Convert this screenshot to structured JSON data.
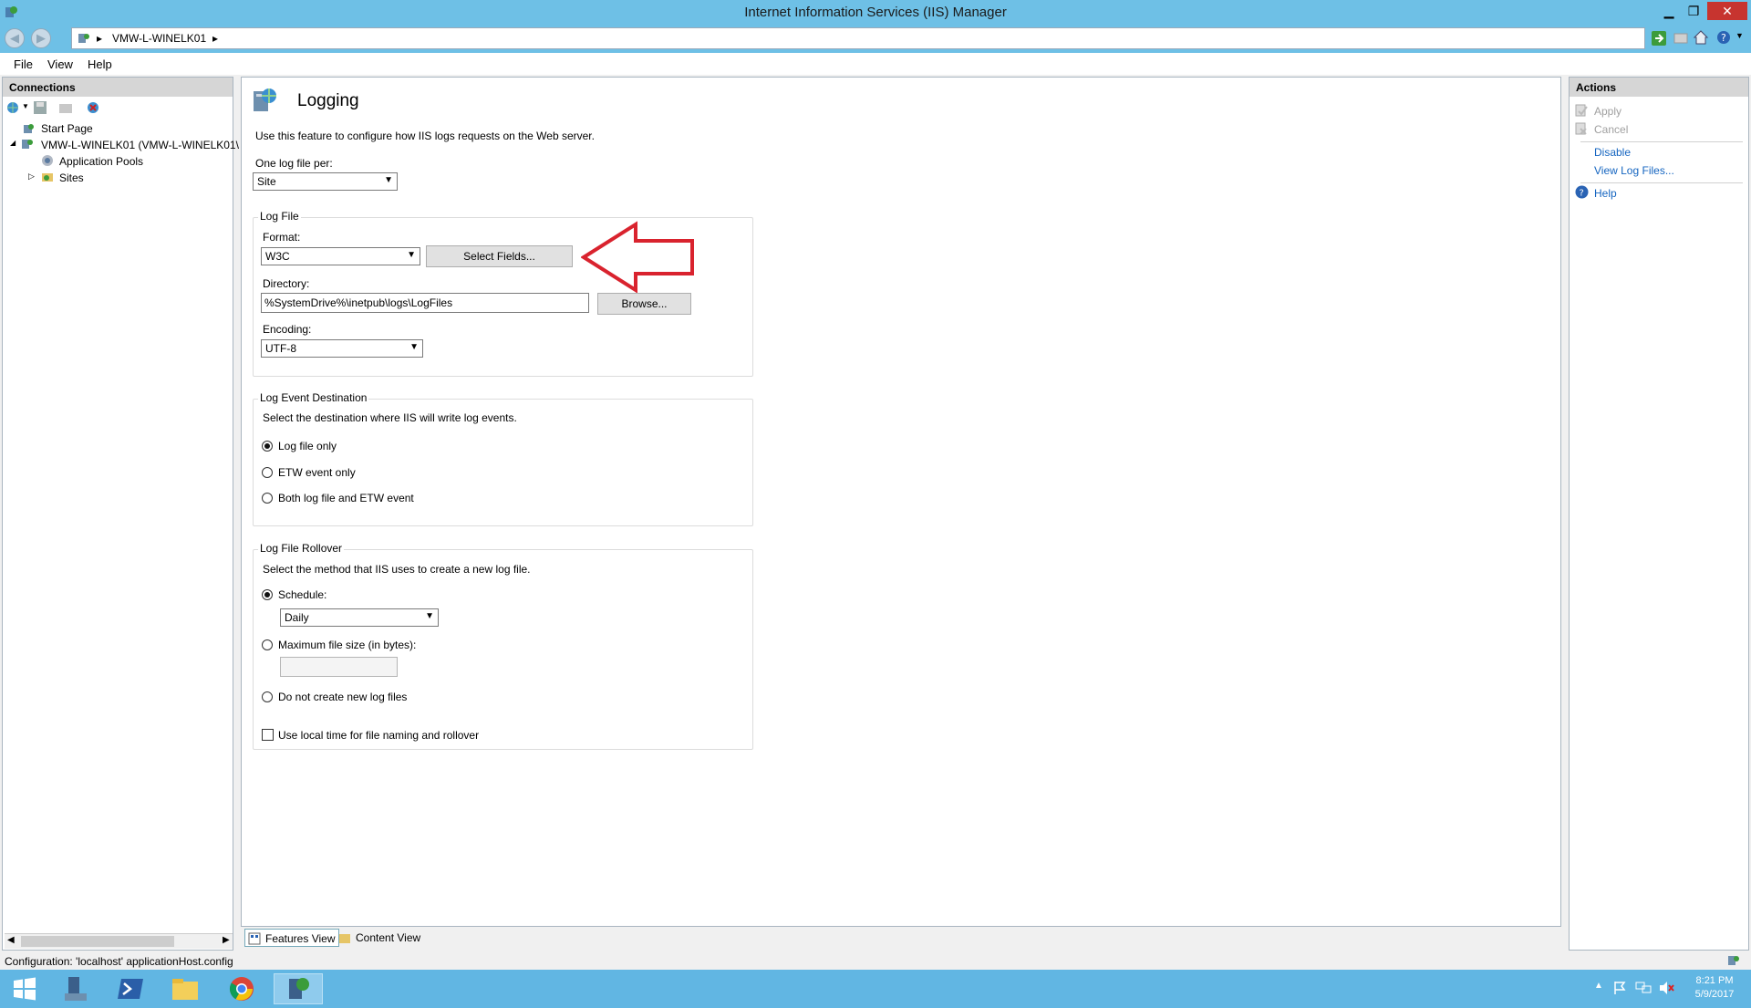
{
  "window": {
    "title": "Internet Information Services (IIS) Manager"
  },
  "address": {
    "crumbs": [
      "VMW-L-WINELK01"
    ],
    "sep": "▸"
  },
  "menu": {
    "items": [
      "File",
      "View",
      "Help"
    ]
  },
  "connections": {
    "header": "Connections",
    "tree": {
      "start_page": "Start Page",
      "server": "VMW-L-WINELK01 (VMW-L-WINELK01\\",
      "app_pools": "Application Pools",
      "sites": "Sites"
    }
  },
  "main": {
    "title": "Logging",
    "description": "Use this feature to configure how IIS logs requests on the Web server.",
    "log_per_label": "One log file per:",
    "log_per_value": "Site",
    "log_file": {
      "group_title": "Log File",
      "format_label": "Format:",
      "format_value": "W3C",
      "select_fields_button": "Select Fields...",
      "directory_label": "Directory:",
      "directory_value": "%SystemDrive%\\inetpub\\logs\\LogFiles",
      "browse_button": "Browse...",
      "encoding_label": "Encoding:",
      "encoding_value": "UTF-8"
    },
    "event_destination": {
      "group_title": "Log Event Destination",
      "description": "Select the destination where IIS will write log events.",
      "options": [
        "Log file only",
        "ETW event only",
        "Both log file and ETW event"
      ],
      "selected_index": 0
    },
    "rollover": {
      "group_title": "Log File Rollover",
      "description": "Select the method that IIS uses to create a new log file.",
      "schedule_label": "Schedule:",
      "schedule_value": "Daily",
      "max_size_label": "Maximum file size (in bytes):",
      "max_size_value": "",
      "no_new_label": "Do not create new log files",
      "local_time_label": "Use local time for file naming and rollover",
      "selected": "Schedule:",
      "local_time_checked": false
    }
  },
  "actions": {
    "header": "Actions",
    "apply": "Apply",
    "cancel": "Cancel",
    "disable": "Disable",
    "view_log_files": "View Log Files...",
    "help": "Help"
  },
  "view_tabs": {
    "features": "Features View",
    "content": "Content View"
  },
  "status": {
    "text": "Configuration: 'localhost' applicationHost.config"
  },
  "taskbar": {
    "time": "8:21 PM",
    "date": "5/9/2017"
  },
  "colors": {
    "annotation_arrow": "#d9232e",
    "link": "#1565c0",
    "titlebar": "#6ec0e6"
  }
}
